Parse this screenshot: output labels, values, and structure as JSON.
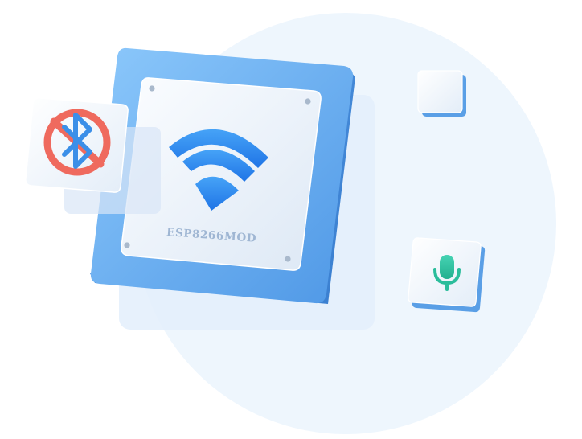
{
  "module": {
    "label": "ESP8266MOD",
    "label_color": "#9fb6d3"
  },
  "icons": {
    "wifi": "wifi-icon",
    "bluetooth_disabled": "bluetooth-disabled-icon",
    "microphone": "microphone-icon"
  },
  "colors": {
    "background_circle": "#eef6fd",
    "module_blue": "#5aa6ec",
    "wifi_blue": "#2f86ef",
    "bluetooth_blue": "#3b8fe8",
    "prohibited_red": "#ef6a5e",
    "microphone_green": "#33c4a1"
  }
}
